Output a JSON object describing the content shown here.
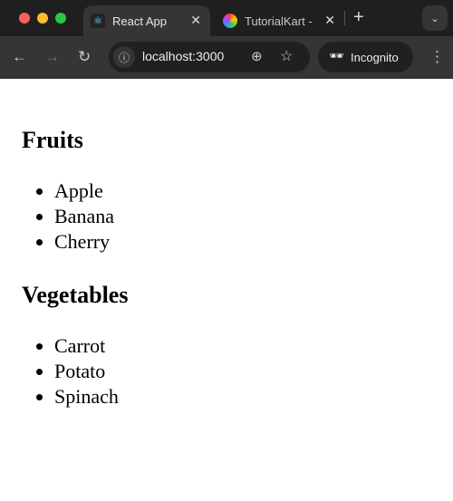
{
  "browser": {
    "tabs": [
      {
        "title": "React App",
        "icon": "react-icon",
        "active": true
      },
      {
        "title": "TutorialKart -",
        "icon": "tutorialkart-icon",
        "active": false
      }
    ],
    "url": "localhost:3000",
    "incognito_label": "Incognito",
    "colors": {
      "close": "#ff5f57",
      "minimize": "#febc2e",
      "maximize": "#28c840"
    }
  },
  "page": {
    "sections": [
      {
        "heading": "Fruits",
        "items": [
          "Apple",
          "Banana",
          "Cherry"
        ]
      },
      {
        "heading": "Vegetables",
        "items": [
          "Carrot",
          "Potato",
          "Spinach"
        ]
      }
    ]
  }
}
